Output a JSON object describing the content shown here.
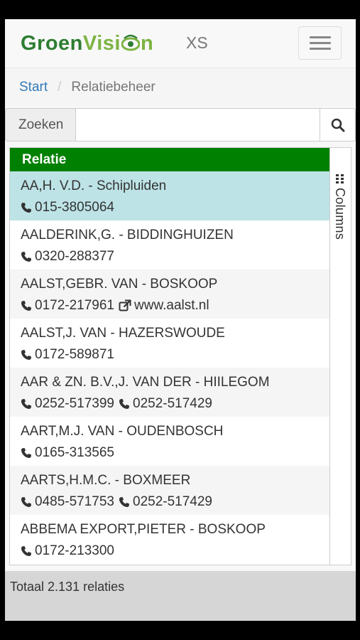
{
  "navbar": {
    "logo_part1": "Groen",
    "logo_part2": "Visi",
    "logo_part3": "n",
    "size_label": "XS"
  },
  "breadcrumb": {
    "home": "Start",
    "current": "Relatiebeheer"
  },
  "search": {
    "label": "Zoeken",
    "value": "",
    "placeholder": ""
  },
  "table": {
    "header": "Relatie",
    "columns_label": "Columns",
    "rows": [
      {
        "name": "AA,H. V.D. - Schipluiden",
        "contacts": [
          {
            "type": "phone",
            "value": "015-3805064"
          }
        ]
      },
      {
        "name": "AALDERINK,G. - BIDDINGHUIZEN",
        "contacts": [
          {
            "type": "phone",
            "value": "0320-288377"
          }
        ]
      },
      {
        "name": "AALST,GEBR. VAN - BOSKOOP",
        "contacts": [
          {
            "type": "phone",
            "value": "0172-217961"
          },
          {
            "type": "web",
            "value": "www.aalst.nl"
          }
        ]
      },
      {
        "name": "AALST,J. VAN - HAZERSWOUDE",
        "contacts": [
          {
            "type": "phone",
            "value": "0172-589871"
          }
        ]
      },
      {
        "name": "AAR & ZN. B.V.,J. VAN DER - HIILEGOM",
        "contacts": [
          {
            "type": "phone",
            "value": "0252-517399"
          },
          {
            "type": "phone",
            "value": "0252-517429"
          }
        ]
      },
      {
        "name": "AART,M.J. VAN - OUDENBOSCH",
        "contacts": [
          {
            "type": "phone",
            "value": "0165-313565"
          }
        ]
      },
      {
        "name": "AARTS,H.M.C. - BOXMEER",
        "contacts": [
          {
            "type": "phone",
            "value": "0485-571753"
          },
          {
            "type": "phone",
            "value": "0252-517429"
          }
        ]
      },
      {
        "name": "ABBEMA EXPORT,PIETER - BOSKOOP",
        "contacts": [
          {
            "type": "phone",
            "value": "0172-213300"
          }
        ]
      }
    ]
  },
  "footer": {
    "total": "Totaal 2.131 relaties"
  },
  "colors": {
    "header_green": "#008000",
    "selected_row": "#bde3e6",
    "link_blue": "#337ab7"
  }
}
